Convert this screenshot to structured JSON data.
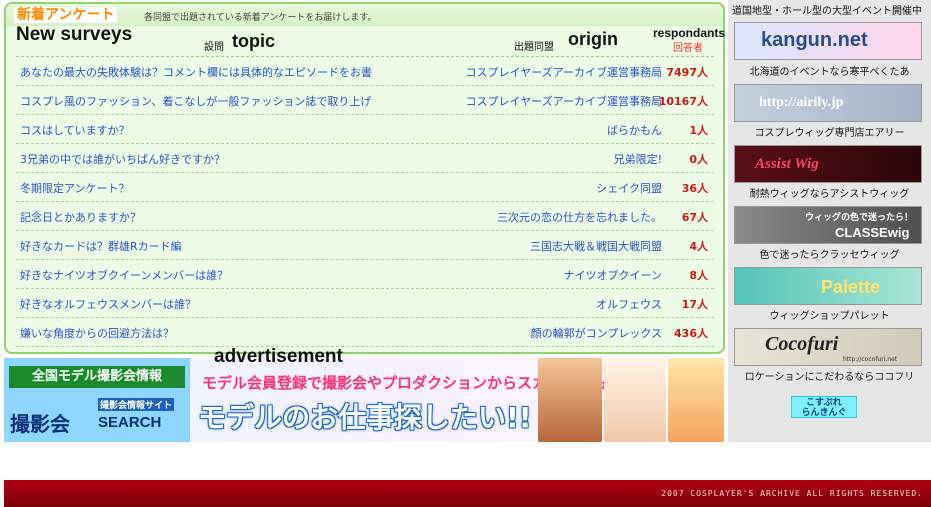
{
  "panel": {
    "title_jp": "新着アンケート",
    "description": "各同盟で出題されている新着アンケートをお届けします。",
    "title_en": "New surveys",
    "header": {
      "topic_jp": "設問",
      "topic_en": "topic",
      "origin_jp": "出題同盟",
      "origin_en": "origin",
      "respondents_en": "respondants",
      "respondents_jp": "回答者"
    },
    "rows": [
      {
        "topic": "あなたの最大の失敗体験は？コメント欄には具体的なエピソードをお書",
        "origin": "コスプレイヤーズアーカイブ運営事務局",
        "count": "7497人"
      },
      {
        "topic": "コスプレ風のファッション、着こなしが一般ファッション誌で取り上げ",
        "origin": "コスプレイヤーズアーカイブ運営事務局",
        "count": "10167人"
      },
      {
        "topic": "コスはしていますか？",
        "origin": "ばらかもん",
        "count": "1人"
      },
      {
        "topic": "3兄弟の中では誰がいちばん好きですか？",
        "origin": "兄弟限定!",
        "count": "0人"
      },
      {
        "topic": "冬期限定アンケート？",
        "origin": "シェイク同盟",
        "count": "36人"
      },
      {
        "topic": "記念日とかありますか？",
        "origin": "三次元の恋の仕方を忘れました。",
        "count": "67人"
      },
      {
        "topic": "好きなカードは？群雄Rカード編",
        "origin": "三国志大戦＆戦国大戦同盟",
        "count": "4人"
      },
      {
        "topic": "好きなナイツオブクイーンメンバーは誰？",
        "origin": "ナイツオブクイーン",
        "count": "8人"
      },
      {
        "topic": "好きなオルフェウスメンバーは誰？",
        "origin": "オルフェウス",
        "count": "17人"
      },
      {
        "topic": "嫌いな角度からの回避方法は？",
        "origin": "顔の輪郭がコンプレックス",
        "count": "436人"
      }
    ]
  },
  "ad": {
    "label": "advertisement",
    "left_top": "全国モデル撮影会情報",
    "left_sub": "撮影会情報サイト",
    "left_main1": "撮影会",
    "left_main2": "SEARCH",
    "copy1": "モデル会員登録で撮影会やプロダクションからスカウトがもらえる",
    "copy2": "モデルのお仕事探したい!!"
  },
  "sidebar": {
    "header": "道国地型・ホール型の大型イベント開催中",
    "banners": [
      {
        "text": "kangun.net",
        "caption": "北海道のイベントなら寒平べくたあ",
        "bg": "#ffe0f0",
        "color": "#2a4d8c"
      },
      {
        "text": "http://airily.jp",
        "caption": "コスプレウィッグ専門店エアリー",
        "bg": "#b9c6d8",
        "color": "#ffffff"
      },
      {
        "text": "Assist Wig",
        "caption": "耐熱ウィッグならアシストウィッグ",
        "bg": "#3b0d12",
        "color": "#ff4466"
      },
      {
        "text": "CLASSEwig",
        "caption": "色で迷ったらクラッセウィッグ",
        "bg": "#6b6b6b",
        "color": "#ffffff"
      },
      {
        "text": "Palette",
        "caption": "ウィッグショップパレット",
        "bg": "#7fd0c0",
        "color": "#ffe36a"
      },
      {
        "text": "Cocofuri",
        "caption": "ロケーションにこだわるならココフリ",
        "bg": "#d9d4c8",
        "color": "#222222"
      }
    ],
    "banner_tag": "ウィッグの色で迷ったら！",
    "palette_url": "http://cocofuri.net",
    "ranking_label_1": "こすぷれ",
    "ranking_label_2": "らんきんぐ"
  },
  "footer": {
    "copyright": "2007 COSPLAYER'S ARCHIVE ALL RIGHTS RESERVED."
  }
}
